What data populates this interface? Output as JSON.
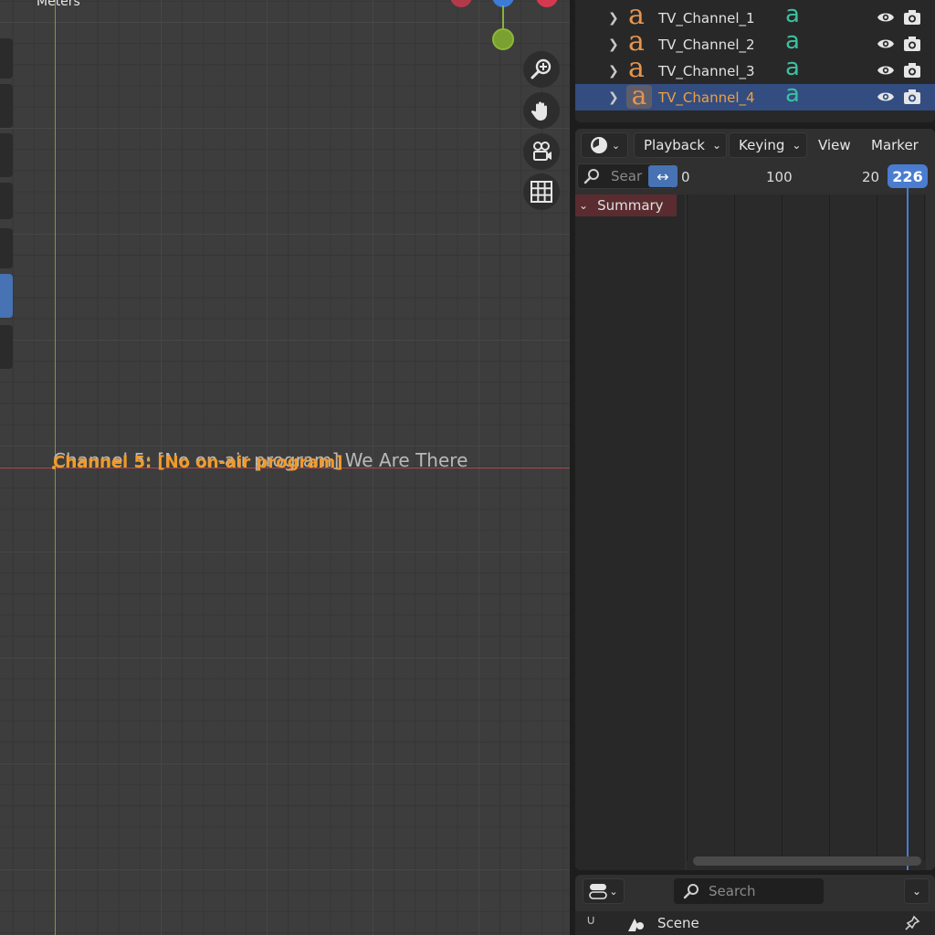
{
  "viewport": {
    "units_label": "Meters",
    "text_objects": {
      "overlay_white": "Channel 5: [No on-air program] We Are There",
      "overlay_orange": "Channel 5: [No on-air program]"
    },
    "nav_buttons": [
      "zoom-icon",
      "hand-pan-icon",
      "camera-icon",
      "grid-icon"
    ]
  },
  "outliner": {
    "rows": [
      {
        "name": "TV_Channel_1",
        "selected": false
      },
      {
        "name": "TV_Channel_2",
        "selected": false
      },
      {
        "name": "TV_Channel_3",
        "selected": false
      },
      {
        "name": "TV_Channel_4",
        "selected": true
      }
    ],
    "object_icon_glyph": "a",
    "data_icon_glyph": "a"
  },
  "dopesheet": {
    "menus": {
      "playback": "Playback",
      "keying": "Keying",
      "view": "View",
      "marker": "Marker"
    },
    "search_placeholder": "Sear",
    "frames": [
      "0",
      "100",
      "20"
    ],
    "current_frame": "226",
    "summary_label": "Summary"
  },
  "bottom": {
    "search_placeholder": "Search",
    "scene_label": "Scene"
  },
  "colors": {
    "selection": "#334d80",
    "playhead": "#4a7cd0",
    "active_text": "#f0a040",
    "text_object_icon": "#e59550",
    "font_data_icon": "#3cc0a0"
  }
}
